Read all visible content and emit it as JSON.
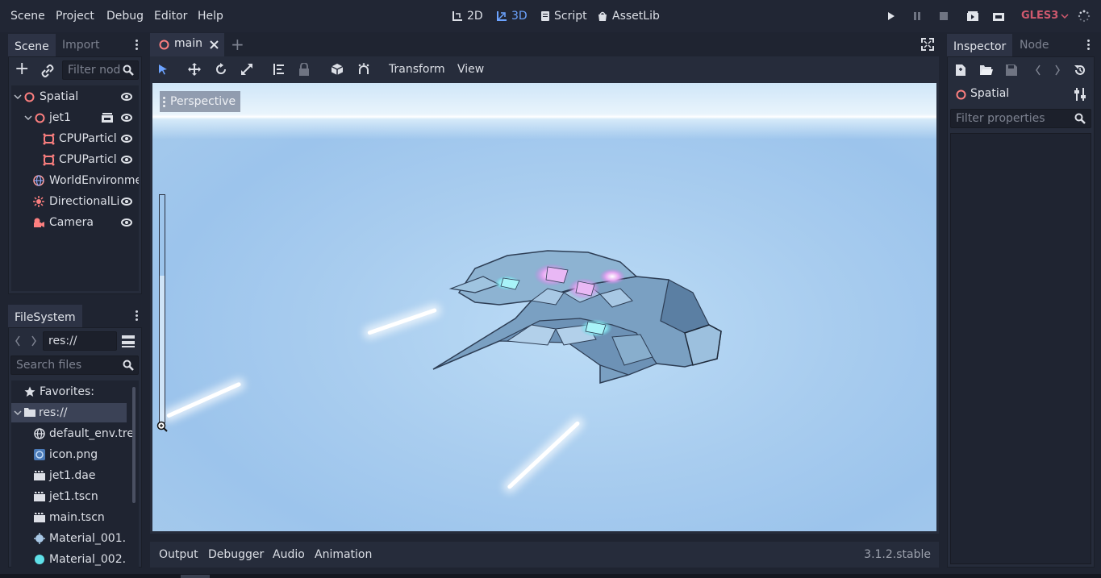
{
  "menu": {
    "items": [
      "Scene",
      "Project",
      "Debug",
      "Editor",
      "Help"
    ]
  },
  "modes": {
    "m2d": "2D",
    "m3d": "3D",
    "script": "Script",
    "assetlib": "AssetLib"
  },
  "renderer": "GLES3",
  "scene_dock": {
    "tabs": [
      "Scene",
      "Import"
    ],
    "filter_placeholder": "Filter nod",
    "tree": [
      {
        "label": "Spatial"
      },
      {
        "label": "jet1"
      },
      {
        "label": "CPUParticl"
      },
      {
        "label": "CPUParticl"
      },
      {
        "label": "WorldEnvironme"
      },
      {
        "label": "DirectionalLi"
      },
      {
        "label": "Camera"
      }
    ]
  },
  "filesystem": {
    "tab": "FileSystem",
    "path": "res://",
    "search_placeholder": "Search files",
    "favorites": "Favorites:",
    "root": "res://",
    "files": [
      "default_env.tre",
      "icon.png",
      "jet1.dae",
      "jet1.tscn",
      "main.tscn",
      "Material_001.",
      "Material_002."
    ]
  },
  "editor": {
    "tab": "main",
    "toolbar_menus": [
      "Transform",
      "View"
    ],
    "perspective_label": "Perspective"
  },
  "bottom": {
    "tabs": [
      "Output",
      "Debugger",
      "Audio",
      "Animation"
    ],
    "version": "3.1.2.stable"
  },
  "inspector": {
    "tabs": [
      "Inspector",
      "Node"
    ],
    "node_name": "Spatial",
    "filter_placeholder": "Filter properties"
  },
  "colors": {
    "accent": "#6ca3ff",
    "renderer": "#d0596e",
    "node_spatial": "#fc7f7f",
    "background": "#1f2431",
    "panel": "#262c3b"
  }
}
